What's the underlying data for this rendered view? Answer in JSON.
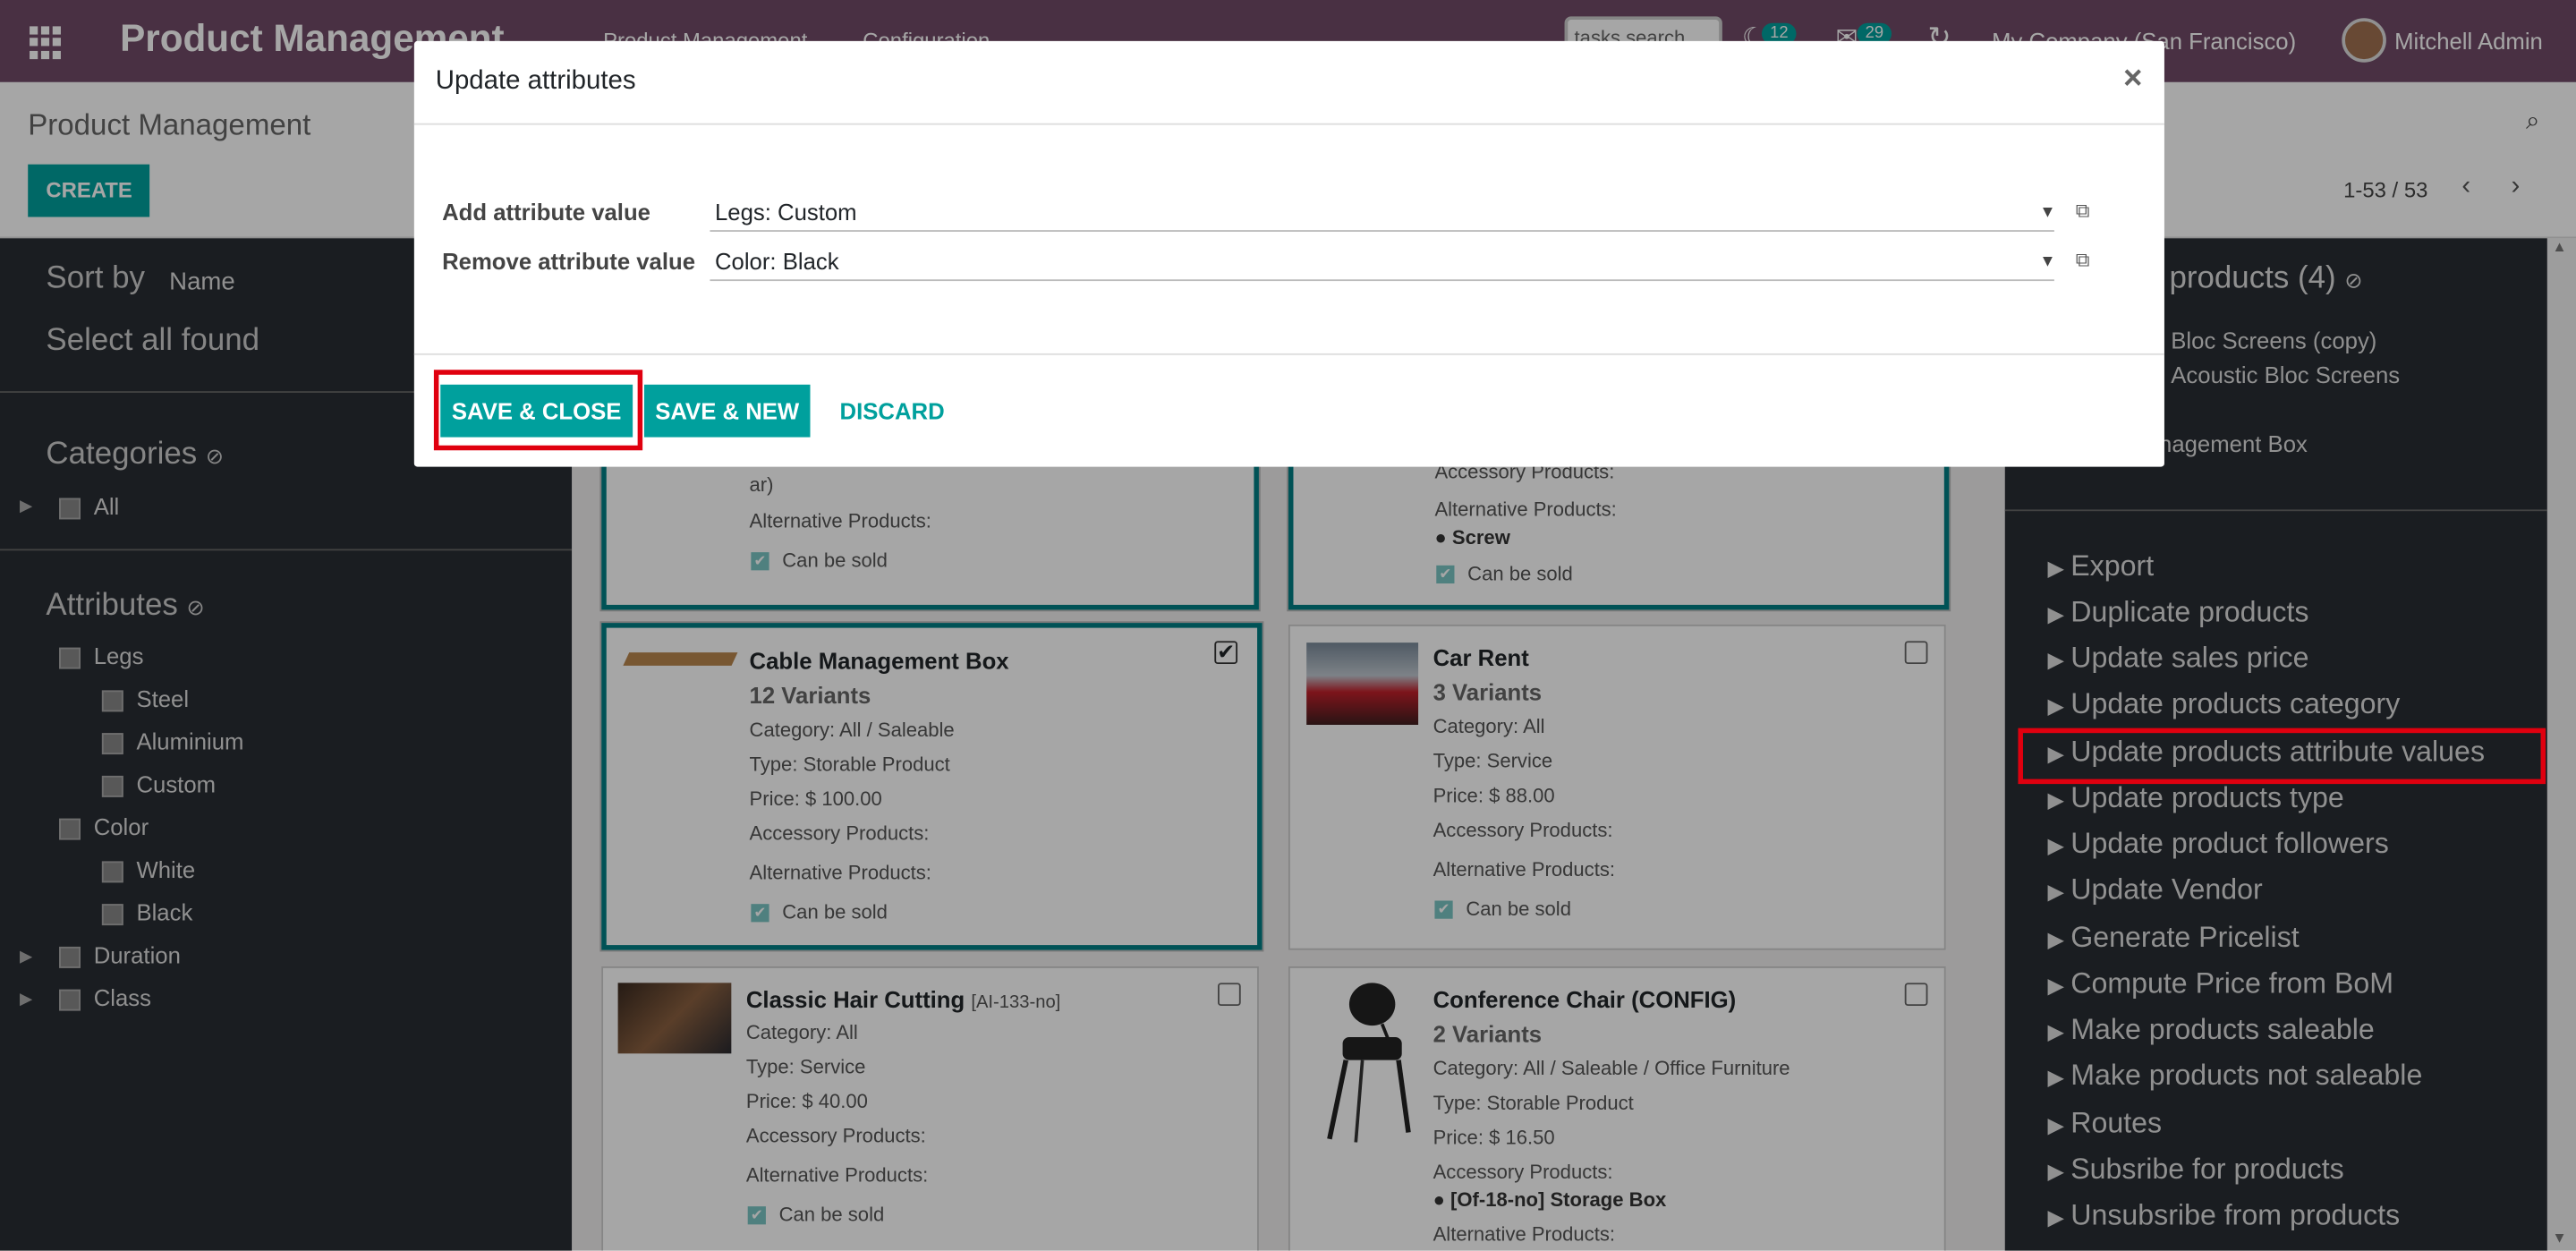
{
  "topbar": {
    "brand": "Product Management",
    "menu_main": "Product Management",
    "menu_config": "Configuration",
    "task_search_placeholder": "tasks search",
    "activity_count": "12",
    "messages_count": "29",
    "company": "My Company (San Francisco)",
    "user": "Mitchell Admin"
  },
  "control_panel": {
    "breadcrumb": "Product Management",
    "create_label": "CREATE",
    "pager": "1-53 / 53"
  },
  "left_panel": {
    "sort_by": "Sort by",
    "sort_field": "Name",
    "select_all": "Select all found",
    "categories_title": "Categories",
    "categories": [
      "All"
    ],
    "attributes_title": "Attributes",
    "attributes": [
      {
        "name": "Legs",
        "values": [
          "Steel",
          "Aluminium",
          "Custom"
        ]
      },
      {
        "name": "Color",
        "values": [
          "White",
          "Black"
        ]
      },
      {
        "name": "Duration",
        "values": []
      },
      {
        "name": "Class",
        "values": []
      }
    ]
  },
  "cards": [
    {
      "title": "Cable Management Box",
      "variants": "12 Variants",
      "category": "Category: All / Saleable",
      "type": "Type: Storable Product",
      "price": "Price: $ 100.00",
      "accessory": "Accessory Products:",
      "alternative": "Alternative Products:",
      "sold": "Can be sold",
      "selected": true
    },
    {
      "title": "Car Rent",
      "variants": "3 Variants",
      "category": "Category: All",
      "type": "Type: Service",
      "price": "Price: $ 88.00",
      "accessory": "Accessory Products:",
      "alternative": "Alternative Products:",
      "sold": "Can be sold",
      "selected": false
    },
    {
      "title": "Classic Hair Cutting",
      "ref": "[AI-133-no]",
      "category": "Category: All",
      "type": "Type: Service",
      "price": "Price: $ 40.00",
      "accessory": "Accessory Products:",
      "alternative": "Alternative Products:",
      "sold": "Can be sold",
      "selected": false
    },
    {
      "title": "Conference Chair (CONFIG)",
      "variants": "2 Variants",
      "category": "Category: All / Saleable / Office Furniture",
      "type": "Type: Storable Product",
      "price": "Price: $ 16.50",
      "accessory": "Accessory Products:",
      "accessory_item": "[Of-18-no] Storage Box",
      "alternative": "Alternative Products:",
      "selected": false
    }
  ],
  "partial_cards": {
    "left_fragment": "ar)",
    "left_alternative": "Alternative Products:",
    "left_sold": "Can be sold",
    "right_accessory": "Accessory Products:",
    "right_alternative": "Alternative Products:",
    "right_alt_item": "Screw",
    "right_sold": "Can be sold"
  },
  "right_panel": {
    "selected_title": "products (4)",
    "selected_items": [
      "Bloc Screens (copy)",
      "Acoustic Bloc Screens",
      "anagement Box"
    ],
    "actions": [
      "Export",
      "Duplicate products",
      "Update sales price",
      "Update products category",
      "Update products attribute values",
      "Update products type",
      "Update product followers",
      "Update Vendor",
      "Generate Pricelist",
      "Compute Price from BoM",
      "Make products saleable",
      "Make products not saleable",
      "Routes",
      "Subsribe for products",
      "Unsubsribe from products"
    ]
  },
  "modal": {
    "title": "Update attributes",
    "close": "×",
    "add_label": "Add attribute value",
    "add_value": "Legs: Custom",
    "remove_label": "Remove attribute value",
    "remove_value": "Color: Black",
    "save_close": "SAVE & CLOSE",
    "save_new": "SAVE & NEW",
    "discard": "DISCARD"
  },
  "colors": {
    "topbar": "#714b67",
    "accent": "#00a09d",
    "panel": "#292d33",
    "highlight": "#e0000f"
  }
}
